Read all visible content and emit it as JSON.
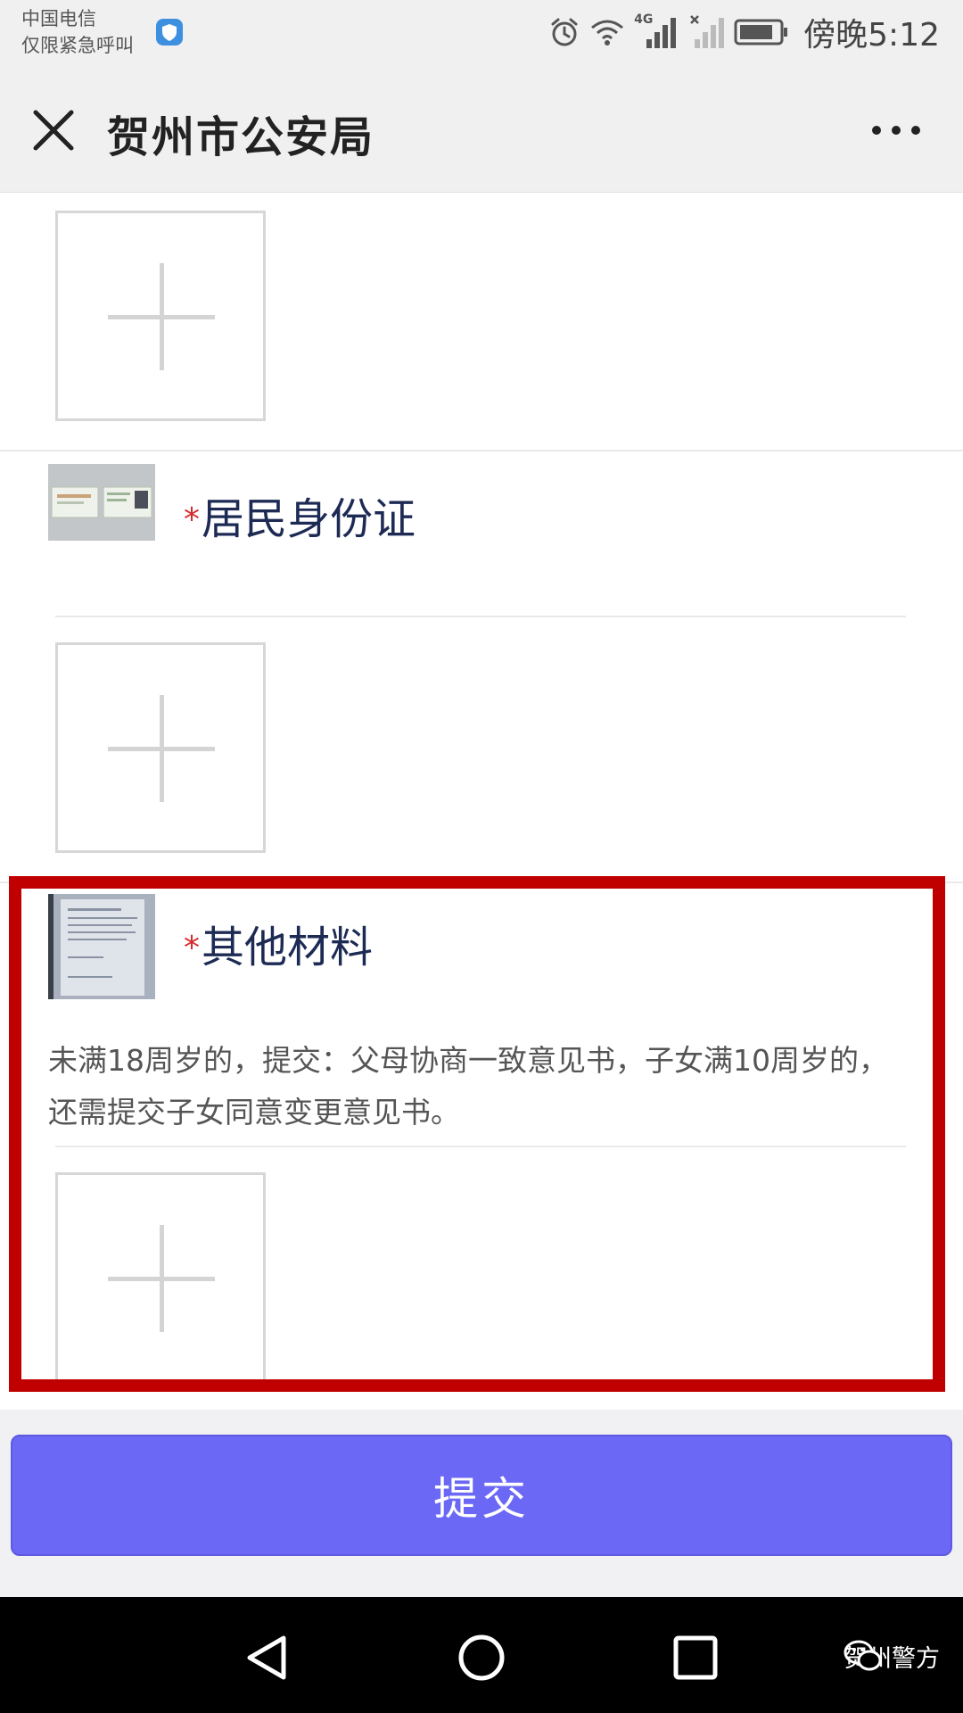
{
  "status_bar": {
    "carrier_line1": "中国电信",
    "carrier_line2": "仅限紧急呼叫",
    "network_label": "4G",
    "time": "傍晚5:12"
  },
  "header": {
    "title": "贺州市公安局"
  },
  "sections": [
    {
      "required_mark": "*",
      "title": "居民身份证"
    },
    {
      "required_mark": "*",
      "title": "其他材料",
      "hint": "未满18周岁的，提交：父母协商一致意见书，子女满10周岁的，还需提交子女同意变更意见书。"
    }
  ],
  "submit_label": "提交",
  "watermark": "贺州警方",
  "colors": {
    "accent": "#6b68f5",
    "required": "#d52b2b",
    "highlight": "#c00000",
    "title": "#1c2a54"
  }
}
